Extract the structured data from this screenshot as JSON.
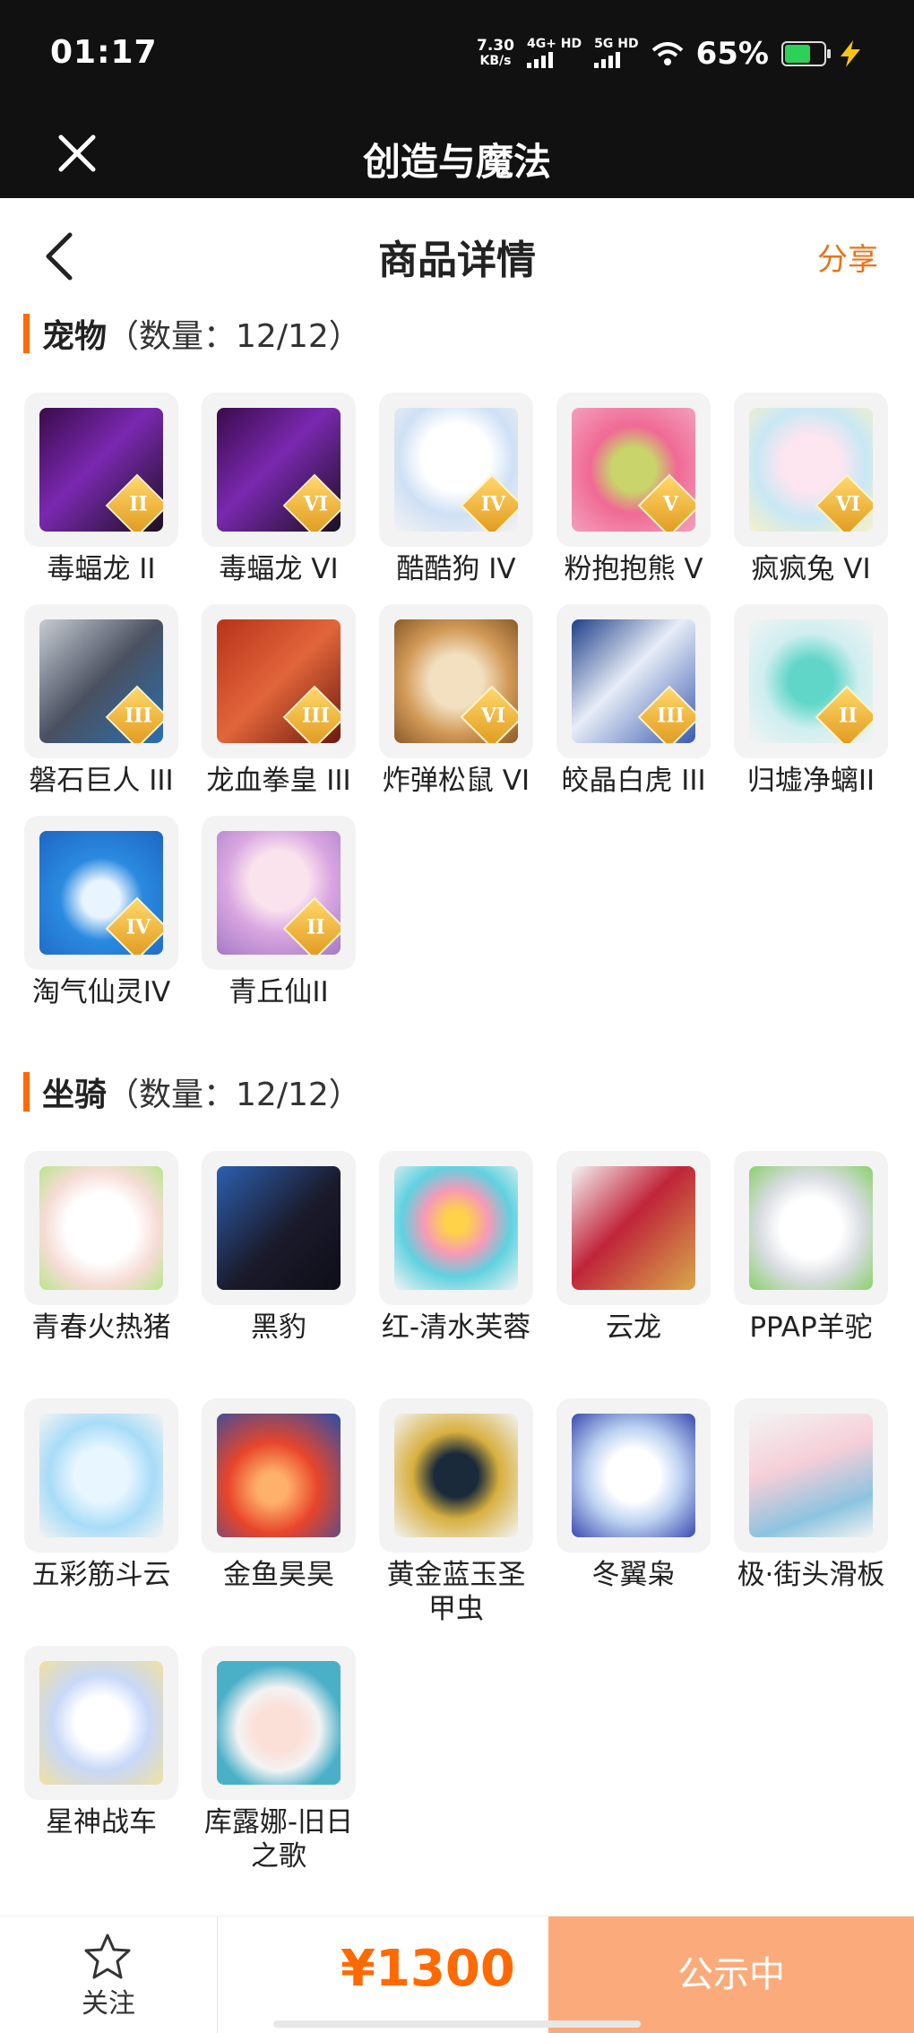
{
  "status_bar": {
    "time": "01:17",
    "speed_value": "7.30",
    "speed_unit": "KB/s",
    "net1": "4G+ HD",
    "net2": "5G HD",
    "battery": "65%"
  },
  "app": {
    "title": "创造与魔法"
  },
  "header": {
    "title": "商品详情",
    "share": "分享"
  },
  "pets": {
    "name": "宠物",
    "count": "（数量：12/12）",
    "items": [
      {
        "label": "毒蝠龙 II",
        "badge": "II"
      },
      {
        "label": "毒蝠龙 VI",
        "badge": "VI"
      },
      {
        "label": "酷酷狗 IV",
        "badge": "IV"
      },
      {
        "label": "粉抱抱熊 V",
        "badge": "V"
      },
      {
        "label": "疯疯兔 VI",
        "badge": "VI"
      },
      {
        "label": "磐石巨人 III",
        "badge": "III"
      },
      {
        "label": "龙血拳皇 III",
        "badge": "III"
      },
      {
        "label": "炸弹松鼠 VI",
        "badge": "VI"
      },
      {
        "label": "皎晶白虎 III",
        "badge": "III"
      },
      {
        "label": "归墟净螭II",
        "badge": "II"
      },
      {
        "label": "淘气仙灵IV",
        "badge": "IV"
      },
      {
        "label": "青丘仙II",
        "badge": "II"
      }
    ]
  },
  "mounts": {
    "name": "坐骑",
    "count": "（数量：12/12）",
    "items": [
      {
        "label": "青春火热猪"
      },
      {
        "label": "黑豹"
      },
      {
        "label": "红-清水芙蓉"
      },
      {
        "label": "云龙"
      },
      {
        "label": "PPAP羊驼"
      },
      {
        "label": "五彩筋斗云"
      },
      {
        "label": "金鱼昊昊"
      },
      {
        "label": "黄金蓝玉圣甲虫"
      },
      {
        "label": "冬翼枭"
      },
      {
        "label": "极·街头滑板"
      },
      {
        "label": "星神战车"
      },
      {
        "label": "库露娜-旧日之歌"
      }
    ]
  },
  "bottom": {
    "follow": "关注",
    "price": "¥1300",
    "status": "公示中"
  }
}
